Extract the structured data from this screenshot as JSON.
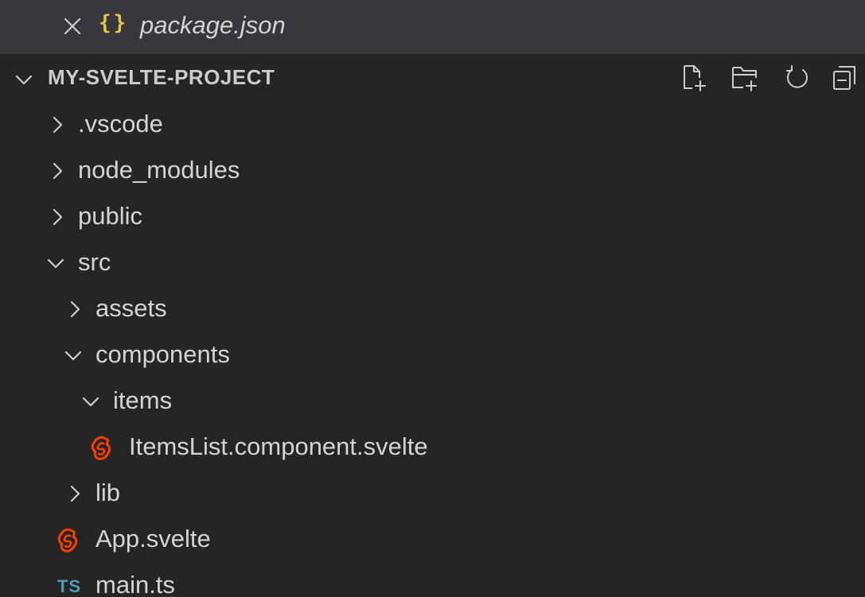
{
  "open_editor": {
    "close_icon": "close-icon",
    "file_icon": "json-braces-icon",
    "file_icon_glyph": "{}",
    "file_name": "package.json",
    "accent": "#e8c547"
  },
  "explorer": {
    "title": "MY-SVELTE-PROJECT",
    "actions": [
      {
        "name": "new-file-button",
        "icon": "new-file-icon"
      },
      {
        "name": "new-folder-button",
        "icon": "new-folder-icon"
      },
      {
        "name": "refresh-button",
        "icon": "refresh-icon"
      },
      {
        "name": "collapse-all-button",
        "icon": "collapse-all-icon"
      }
    ]
  },
  "tree": {
    "items": [
      {
        "label": ".vscode",
        "type": "folder",
        "expanded": false
      },
      {
        "label": "node_modules",
        "type": "folder",
        "expanded": false
      },
      {
        "label": "public",
        "type": "folder",
        "expanded": false
      },
      {
        "label": "src",
        "type": "folder",
        "expanded": true
      },
      {
        "label": "assets",
        "type": "folder",
        "expanded": false
      },
      {
        "label": "components",
        "type": "folder",
        "expanded": true
      },
      {
        "label": "items",
        "type": "folder",
        "expanded": true
      },
      {
        "label": "ItemsList.component.svelte",
        "type": "svelte-file"
      },
      {
        "label": "lib",
        "type": "folder",
        "expanded": false
      },
      {
        "label": "App.svelte",
        "type": "svelte-file"
      },
      {
        "label": "main.ts",
        "type": "ts-file",
        "icon_glyph": "TS"
      }
    ],
    "colors": {
      "svelte": "#ff3e00",
      "typescript": "#519aba",
      "text": "#d4d4d4"
    }
  }
}
